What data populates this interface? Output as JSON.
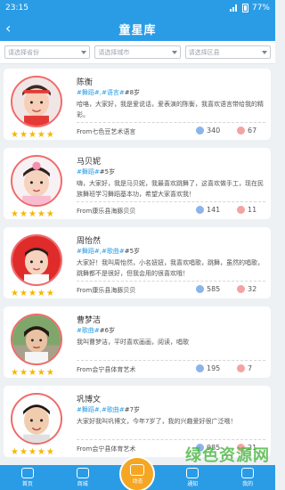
{
  "status": {
    "time": "23:15",
    "battery": "77%"
  },
  "header": {
    "back": "‹",
    "title": "童星库"
  },
  "filters": [
    {
      "placeholder": "请选择省份"
    },
    {
      "placeholder": "请选择城市"
    },
    {
      "placeholder": "请选择区县"
    }
  ],
  "cards": [
    {
      "name": "陈衡",
      "tags": "#舞蹈#,#语言#",
      "age": "8岁",
      "desc": "哈咯，大家好，我是爱说话，爱表演的陈衡，我喜欢语言带给我的精彩。",
      "from": "From七色豆艺术语言",
      "views": "340",
      "likes": "67",
      "avatar": "girl-red-hairband"
    },
    {
      "name": "马贝妮",
      "tags": "#舞蹈#",
      "age": "5岁",
      "desc": "嗨，大家好，我是马贝妮，我最喜欢跳舞了，这喜欢做手工，现在民族舞班学习舞蹈基本功，希望大家喜欢我！",
      "from": "From康乐县海豚贝贝",
      "views": "141",
      "likes": "11",
      "avatar": "girl-pink-bow"
    },
    {
      "name": "周怡然",
      "tags": "#舞蹈#,#歌曲#",
      "age": "5岁",
      "desc": "大家好！我叫周怡然，小名妞妞，我喜欢唱歌，跳舞，虽然的唱歌，跳舞都不是很好，但我会用的很喜欢哦！",
      "from": "From康乐县海豚贝贝",
      "views": "585",
      "likes": "32",
      "avatar": "boy-red-background"
    },
    {
      "name": "曹梦洁",
      "tags": "#歌曲#",
      "age": "6岁",
      "desc": "我叫曹梦洁，平时喜欢画画，阅读，唱歌",
      "from": "From会宁县体育艺术",
      "views": "195",
      "likes": "7",
      "avatar": "girl-outdoor"
    },
    {
      "name": "巩博文",
      "tags": "#舞蹈#,#歌曲#",
      "age": "7岁",
      "desc": "大家好我叫巩博文，今年7岁了，我的兴趣爱好很广泛哦！",
      "from": "From会宁县体育艺术",
      "views": "985",
      "likes": "21",
      "avatar": "boy-white-background"
    }
  ],
  "tabs": [
    {
      "label": "首页"
    },
    {
      "label": "商城"
    },
    {
      "label": "动态"
    },
    {
      "label": "通知"
    },
    {
      "label": "我的"
    }
  ],
  "watermark": "绿色资源网",
  "colors": {
    "primary": "#2a9ce6",
    "tag": "#2a9ce6",
    "star": "#f5b800",
    "center_tab": "#f5a623",
    "avatar_ring": "#f06a6a"
  }
}
